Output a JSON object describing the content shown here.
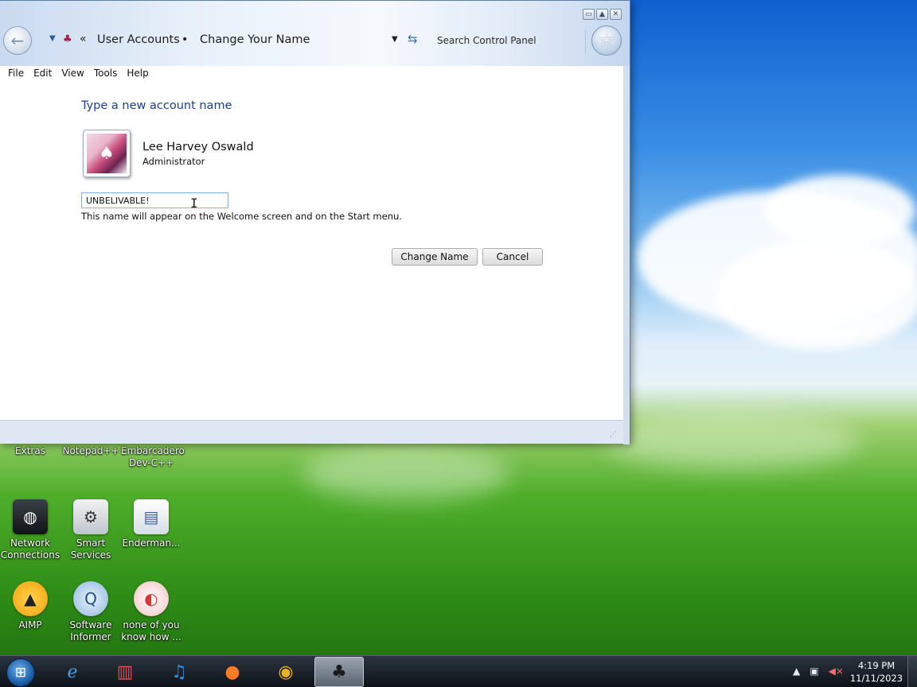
{
  "window": {
    "breadcrumb": [
      "User Accounts",
      "Change Your Name"
    ],
    "breadcrumb_separator": "•",
    "search_placeholder": "Search Control Panel",
    "caption_buttons": [
      "minimize",
      "maximize",
      "close"
    ]
  },
  "menu": [
    "File",
    "Edit",
    "View",
    "Tools",
    "Help"
  ],
  "page": {
    "heading": "Type a new account name",
    "user_name": "Lee Harvey Oswald",
    "user_role": "Administrator",
    "new_name_value": "UNBELIVABLE!",
    "hint": "This name will appear on the Welcome screen and on the Start menu.",
    "change_button": "Change Name",
    "cancel_button": "Cancel"
  },
  "desktop_icons": [
    {
      "label": "Extras",
      "icon": "folder-icon"
    },
    {
      "label": "Notepad++",
      "icon": "notepad-icon"
    },
    {
      "label": "Embarcadero Dev-C++",
      "icon": "devcpp-icon"
    },
    {
      "label": "Network Connections",
      "icon": "network-icon"
    },
    {
      "label": "Smart Services",
      "icon": "services-icon"
    },
    {
      "label": "Enderman...",
      "icon": "shortcut-icon"
    },
    {
      "label": "AIMP",
      "icon": "aimp-icon"
    },
    {
      "label": "Software Informer",
      "icon": "informer-icon"
    },
    {
      "label": "none of you know how ...",
      "icon": "app-icon"
    }
  ],
  "taskbar": {
    "items": [
      "start-orb",
      "internet-explorer-icon",
      "archive-icon",
      "music-player-icon",
      "firefox-icon",
      "chrome-icon",
      "user-accounts-icon"
    ],
    "time": "4:19 PM",
    "date": "11/11/2023"
  },
  "colors": {
    "heading": "#1e3f8c",
    "input_border": "#8ab0d8",
    "taskbar": "#0d1219"
  }
}
